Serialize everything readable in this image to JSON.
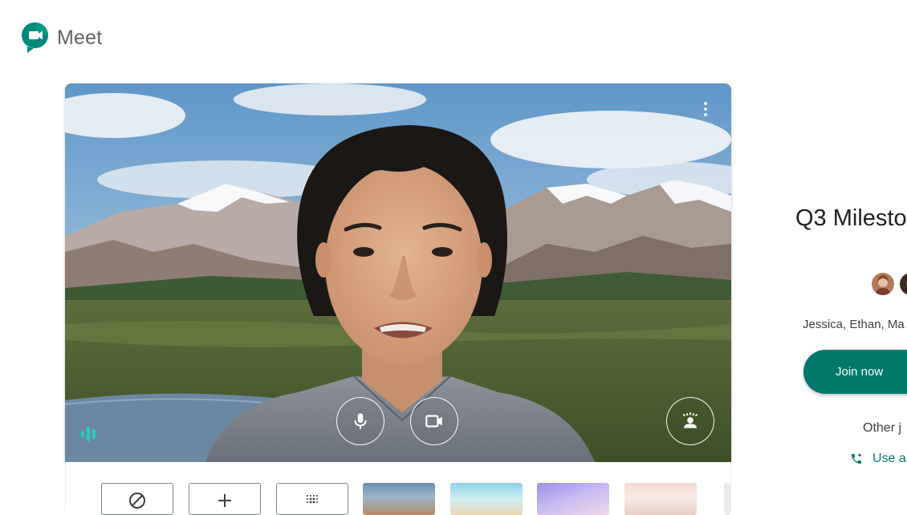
{
  "app": {
    "name": "Meet"
  },
  "meeting": {
    "title": "Q3 Milestone",
    "attendees_text": "Jessica, Ethan, Ma",
    "join_label": "Join now",
    "other_options_label": "Other j",
    "phone_option_label": "Use a"
  },
  "preview_controls": {
    "microphone": "mic-icon",
    "camera": "videocam-icon",
    "background": "background-effects-icon",
    "more": "more-vert-icon"
  },
  "effects_strip": {
    "tiles": [
      {
        "type": "none",
        "icon": "block-icon"
      },
      {
        "type": "add",
        "icon": "add-icon"
      },
      {
        "type": "blur",
        "icon": "blur-icon"
      },
      {
        "type": "image",
        "colors": [
          "#6a8fb4",
          "#b48c68"
        ]
      },
      {
        "type": "image",
        "colors": [
          "#8ed3e6",
          "#e8d9b5"
        ]
      },
      {
        "type": "image",
        "colors": [
          "#9c8ee6",
          "#f0d8ec"
        ]
      },
      {
        "type": "image",
        "colors": [
          "#f2dcd4",
          "#e8cfc6"
        ]
      }
    ]
  },
  "colors": {
    "accent": "#00796b",
    "audio_level": "#26d0b7",
    "logo_green": "#00897b"
  }
}
